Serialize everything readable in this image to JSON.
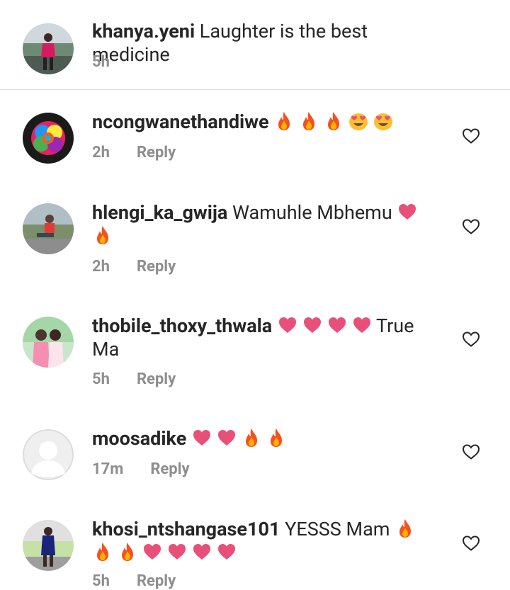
{
  "caption": {
    "username": "khanya.yeni",
    "text": "Laughter is the best medicine",
    "time": "5h"
  },
  "comments": [
    {
      "username": "ncongwanethandiwe",
      "text": "",
      "emojis": [
        "fire",
        "fire",
        "fire",
        "heart-eyes",
        "heart-eyes"
      ],
      "time": "2h",
      "reply": "Reply",
      "avatar": "rainbow-rose-avatar"
    },
    {
      "username": "hlengi_ka_gwija",
      "text": "Wamuhle Mbhemu",
      "emojis": [
        "heart",
        "fire"
      ],
      "time": "2h",
      "reply": "Reply",
      "avatar": "person-outdoors-avatar"
    },
    {
      "username": "thobile_thoxy_thwala",
      "text": "True Ma",
      "emojis": [
        "heart",
        "heart",
        "heart",
        "heart"
      ],
      "time": "5h",
      "reply": "Reply",
      "avatar": "two-people-avatar"
    },
    {
      "username": "moosadike",
      "text": "",
      "emojis": [
        "heart",
        "heart",
        "fire",
        "fire"
      ],
      "time": "17m",
      "reply": "Reply",
      "avatar": "default-avatar"
    },
    {
      "username": "khosi_ntshangase101",
      "text": "YESSS Mam",
      "emojis": [
        "fire",
        "fire",
        "fire",
        "heart",
        "heart",
        "heart",
        "heart"
      ],
      "time": "5h",
      "reply": "Reply",
      "avatar": "person-standing-avatar"
    }
  ],
  "colors": {
    "text": "#262626",
    "meta": "#8e8e8e",
    "divider": "#dbdbdb",
    "heart_emoji": "#e8507a",
    "fire_emoji": "#f4511e"
  }
}
